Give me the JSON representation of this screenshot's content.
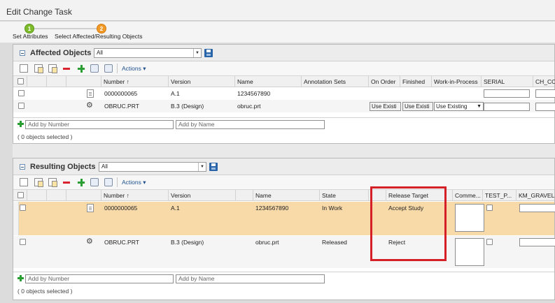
{
  "window": {
    "title": "Edit Change Task"
  },
  "wizard": {
    "steps": [
      {
        "number": "1",
        "label": "Set Attributes"
      },
      {
        "number": "2",
        "label": "Select Affected/Resulting Objects"
      }
    ]
  },
  "affected": {
    "title": "Affected Objects",
    "view": "All",
    "actions_label": "Actions",
    "columns": [
      "Number",
      "Version",
      "Name",
      "Annotation Sets",
      "On Order",
      "Finished",
      "Work-in-Process",
      "SERIAL",
      "CH_CO"
    ],
    "sort_marker": "↑",
    "rows": [
      {
        "number": "0000000065",
        "version": "A.1",
        "name": "1234567890"
      },
      {
        "number": "OBRUC.PRT",
        "version": "B.3 (Design)",
        "name": "obruc.prt",
        "on_order": "Use Existi",
        "finished": "Use Existi",
        "wip": "Use Existing"
      }
    ],
    "add_number_placeholder": "Add by Number",
    "add_name_placeholder": "Add by Name",
    "status": "( 0 objects selected )"
  },
  "resulting": {
    "title": "Resulting Objects",
    "view": "All",
    "actions_label": "Actions",
    "columns": [
      "Number",
      "Version",
      "Name",
      "State",
      "Release Target",
      "Comme...",
      "TEST_P...",
      "KM_GRAVEL"
    ],
    "sort_marker": "↑",
    "rows": [
      {
        "number": "0000000065",
        "version": "A.1",
        "name": "1234567890",
        "state": "In Work",
        "release_target": "Accept Study"
      },
      {
        "number": "OBRUC.PRT",
        "version": "B.3 (Design)",
        "name": "obruc.prt",
        "state": "Released",
        "release_target": "Reject"
      }
    ],
    "add_number_placeholder": "Add by Number",
    "add_name_placeholder": "Add by Name",
    "status": "( 0 objects selected )"
  },
  "colors": {
    "selected_row": "#f8d9a8",
    "highlight_box": "#d42026",
    "step_done": "#7dba2c",
    "step_current": "#f29a28"
  },
  "icons": [
    "copy-icon",
    "paste-icon",
    "paste-special-icon",
    "remove-icon",
    "add-icon",
    "refresh-icon",
    "collect-icon",
    "document-icon",
    "gear-icon",
    "save-icon",
    "collapse-icon",
    "sort-up-icon"
  ]
}
